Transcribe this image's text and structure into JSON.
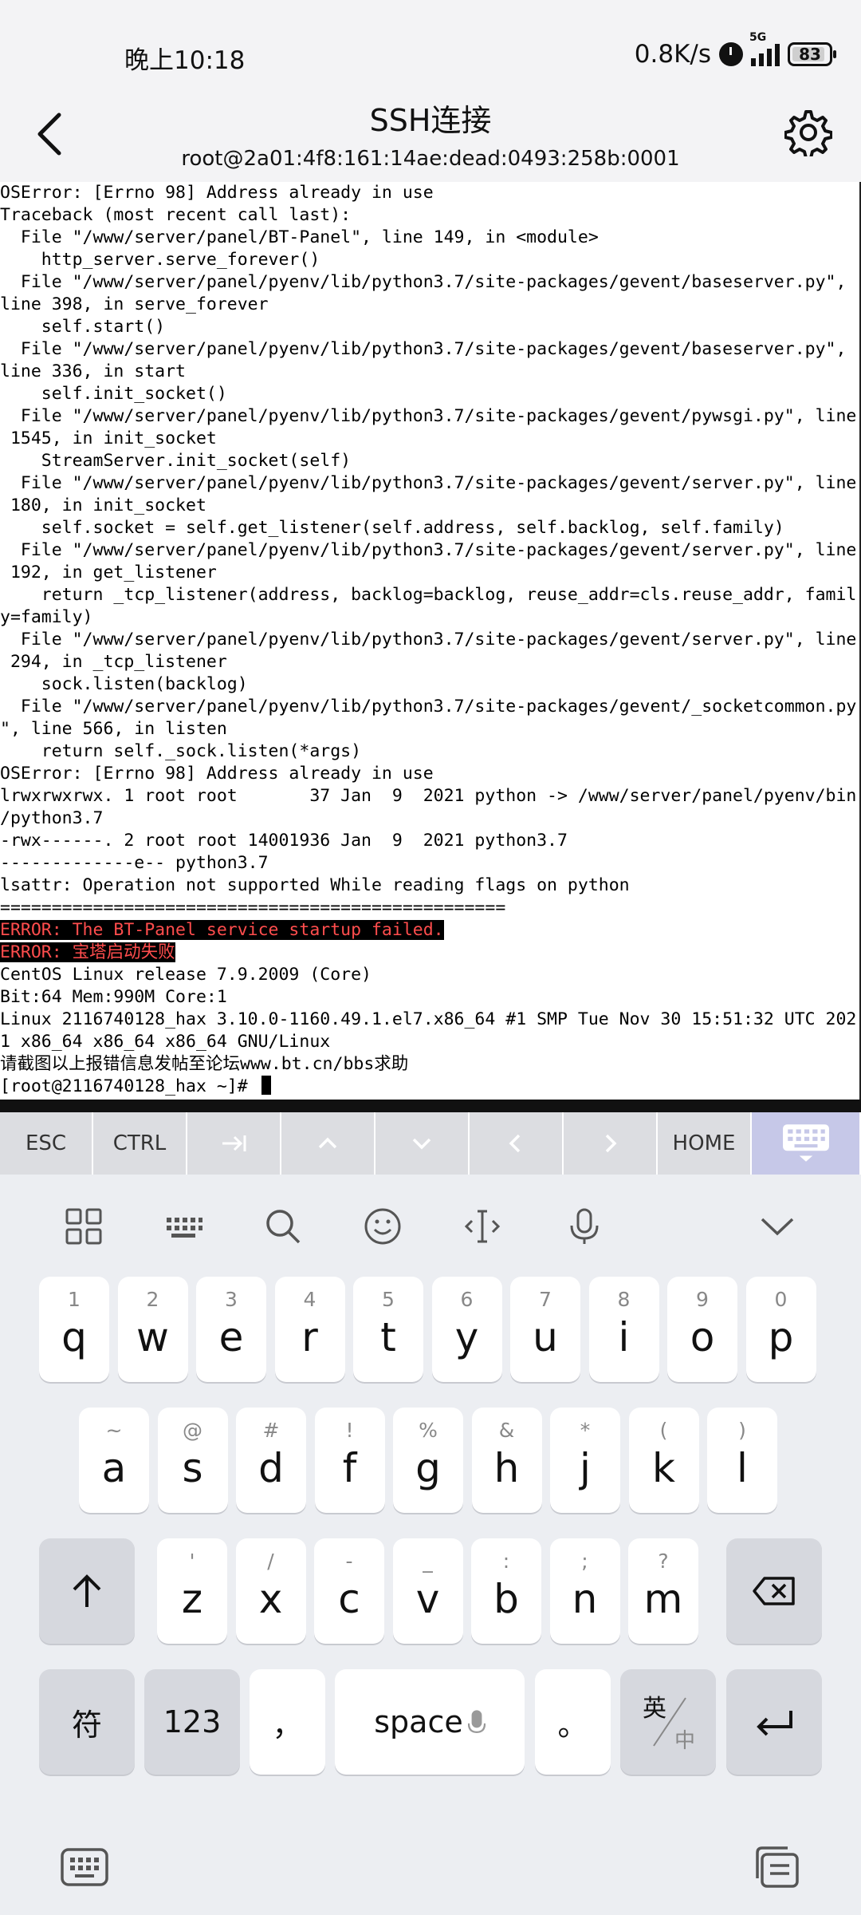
{
  "status_bar": {
    "time": "晚上10:18",
    "speed": "0.8K/s",
    "network": "5G",
    "battery": "83"
  },
  "header": {
    "title": "SSH连接",
    "subtitle": "root@2a01:4f8:161:14ae:dead:0493:258b:0001"
  },
  "terminal": {
    "lines": [
      "OSError: [Errno 98] Address already in use",
      "Traceback (most recent call last):",
      "  File \"/www/server/panel/BT-Panel\", line 149, in <module>",
      "    http_server.serve_forever()",
      "  File \"/www/server/panel/pyenv/lib/python3.7/site-packages/gevent/baseserver.py\",",
      "line 398, in serve_forever",
      "    self.start()",
      "  File \"/www/server/panel/pyenv/lib/python3.7/site-packages/gevent/baseserver.py\",",
      "line 336, in start",
      "    self.init_socket()",
      "  File \"/www/server/panel/pyenv/lib/python3.7/site-packages/gevent/pywsgi.py\", line",
      " 1545, in init_socket",
      "    StreamServer.init_socket(self)",
      "  File \"/www/server/panel/pyenv/lib/python3.7/site-packages/gevent/server.py\", line",
      " 180, in init_socket",
      "    self.socket = self.get_listener(self.address, self.backlog, self.family)",
      "  File \"/www/server/panel/pyenv/lib/python3.7/site-packages/gevent/server.py\", line",
      " 192, in get_listener",
      "    return _tcp_listener(address, backlog=backlog, reuse_addr=cls.reuse_addr, famil",
      "y=family)",
      "  File \"/www/server/panel/pyenv/lib/python3.7/site-packages/gevent/server.py\", line",
      " 294, in _tcp_listener",
      "    sock.listen(backlog)",
      "  File \"/www/server/panel/pyenv/lib/python3.7/site-packages/gevent/_socketcommon.py",
      "\", line 566, in listen",
      "    return self._sock.listen(*args)",
      "OSError: [Errno 98] Address already in use",
      "lrwxrwxrwx. 1 root root       37 Jan  9  2021 python -> /www/server/panel/pyenv/bin",
      "/python3.7",
      "-rwx------. 2 root root 14001936 Jan  9  2021 python3.7",
      "-------------e-- python3.7",
      "lsattr: Operation not supported While reading flags on python",
      "================================================="
    ],
    "error_lines": [
      "ERROR: The BT-Panel service startup failed.",
      "ERROR: 宝塔启动失败"
    ],
    "after_lines": [
      "CentOS Linux release 7.9.2009 (Core)",
      "Bit:64 Mem:990M Core:1",
      "Linux 2116740128_hax 3.10.0-1160.49.1.el7.x86_64 #1 SMP Tue Nov 30 15:51:32 UTC 202",
      "1 x86_64 x86_64 x86_64 GNU/Linux",
      "请截图以上报错信息发帖至论坛www.bt.cn/bbs求助"
    ],
    "prompt": "[root@2116740128_hax ~]# "
  },
  "extra_keys": [
    "ESC",
    "CTRL",
    "tab-icon",
    "up-icon",
    "down-icon",
    "left-icon",
    "right-icon",
    "HOME",
    "keyboard-icon"
  ],
  "keyboard": {
    "row1": [
      {
        "key": "q",
        "hint": "1"
      },
      {
        "key": "w",
        "hint": "2"
      },
      {
        "key": "e",
        "hint": "3"
      },
      {
        "key": "r",
        "hint": "4"
      },
      {
        "key": "t",
        "hint": "5"
      },
      {
        "key": "y",
        "hint": "6"
      },
      {
        "key": "u",
        "hint": "7"
      },
      {
        "key": "i",
        "hint": "8"
      },
      {
        "key": "o",
        "hint": "9"
      },
      {
        "key": "p",
        "hint": "0"
      }
    ],
    "row2": [
      {
        "key": "a",
        "hint": "~"
      },
      {
        "key": "s",
        "hint": "@"
      },
      {
        "key": "d",
        "hint": "#"
      },
      {
        "key": "f",
        "hint": "!"
      },
      {
        "key": "g",
        "hint": "%"
      },
      {
        "key": "h",
        "hint": "&"
      },
      {
        "key": "j",
        "hint": "*"
      },
      {
        "key": "k",
        "hint": "("
      },
      {
        "key": "l",
        "hint": ")"
      }
    ],
    "row3": [
      {
        "key": "z",
        "hint": "'"
      },
      {
        "key": "x",
        "hint": "/"
      },
      {
        "key": "c",
        "hint": "-"
      },
      {
        "key": "v",
        "hint": "_"
      },
      {
        "key": "b",
        "hint": ":"
      },
      {
        "key": "n",
        "hint": ";"
      },
      {
        "key": "m",
        "hint": "?"
      }
    ],
    "symbols_label": "符",
    "numbers_label": "123",
    "comma_label": "，",
    "space_label": "space",
    "period_label": "。",
    "lang_label_top": "英",
    "lang_label_bottom": "中"
  }
}
